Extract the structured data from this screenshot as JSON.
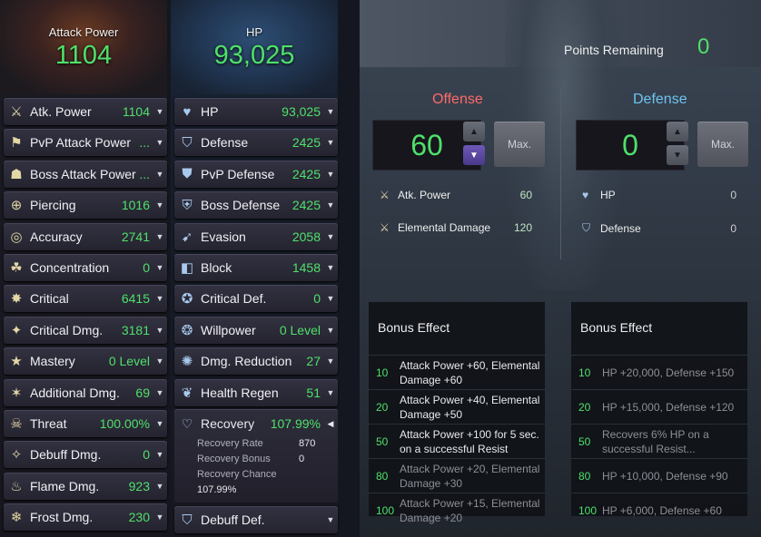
{
  "attack": {
    "title": "Attack Power",
    "value": "1104",
    "rows": [
      {
        "label": "Atk. Power",
        "value": "1104",
        "icon": "swords-icon"
      },
      {
        "label": "PvP Attack Power",
        "value": "...",
        "icon": "pvp-attack-icon"
      },
      {
        "label": "Boss Attack Power",
        "value": "...",
        "icon": "boss-attack-icon"
      },
      {
        "label": "Piercing",
        "value": "1016",
        "icon": "piercing-icon"
      },
      {
        "label": "Accuracy",
        "value": "2741",
        "icon": "accuracy-icon"
      },
      {
        "label": "Concentration",
        "value": "0",
        "icon": "concentration-icon"
      },
      {
        "label": "Critical",
        "value": "6415",
        "icon": "critical-icon"
      },
      {
        "label": "Critical Dmg.",
        "value": "3181",
        "icon": "critical-damage-icon"
      },
      {
        "label": "Mastery",
        "value": "0 Level",
        "icon": "mastery-icon"
      },
      {
        "label": "Additional Dmg.",
        "value": "69",
        "icon": "additional-damage-icon"
      },
      {
        "label": "Threat",
        "value": "100.00%",
        "icon": "threat-skull-icon"
      },
      {
        "label": "Debuff Dmg.",
        "value": "0",
        "icon": "debuff-damage-icon"
      },
      {
        "label": "Flame Dmg.",
        "value": "923",
        "icon": "flame-icon"
      },
      {
        "label": "Frost Dmg.",
        "value": "230",
        "icon": "frost-icon"
      }
    ]
  },
  "hp": {
    "title": "HP",
    "value": "93,025",
    "rows": [
      {
        "label": "HP",
        "value": "93,025",
        "icon": "heart-icon"
      },
      {
        "label": "Defense",
        "value": "2425",
        "icon": "shield-icon"
      },
      {
        "label": "PvP Defense",
        "value": "2425",
        "icon": "pvp-defense-icon"
      },
      {
        "label": "Boss Defense",
        "value": "2425",
        "icon": "boss-defense-icon"
      },
      {
        "label": "Evasion",
        "value": "2058",
        "icon": "evasion-icon"
      },
      {
        "label": "Block",
        "value": "1458",
        "icon": "block-icon"
      },
      {
        "label": "Critical Def.",
        "value": "0",
        "icon": "critical-defense-icon"
      },
      {
        "label": "Willpower",
        "value": "0 Level",
        "icon": "willpower-icon"
      },
      {
        "label": "Dmg. Reduction",
        "value": "27",
        "icon": "damage-reduction-icon"
      },
      {
        "label": "Health Regen",
        "value": "51",
        "icon": "health-regen-icon"
      }
    ],
    "recovery": {
      "label": "Recovery",
      "value": "107.99%",
      "icon": "recovery-icon",
      "details": [
        {
          "k": "Recovery Rate",
          "v": "870"
        },
        {
          "k": "Recovery Bonus",
          "v": "0"
        },
        {
          "k": "Recovery Chance",
          "v": "107.99%"
        }
      ]
    },
    "debuff": {
      "label": "Debuff Def.",
      "icon": "debuff-defense-icon"
    }
  },
  "points": {
    "label": "Points Remaining",
    "value": "0"
  },
  "offense": {
    "title": "Offense",
    "value": "60",
    "max_label": "Max.",
    "stats": [
      {
        "label": "Atk. Power",
        "value": "60",
        "icon": "swords-icon"
      },
      {
        "label": "Elemental Damage",
        "value": "120",
        "icon": "swords-icon"
      }
    ],
    "bonus_title": "Bonus Effect",
    "bonus": [
      {
        "level": "10",
        "text": "Attack Power +60, Elemental Damage +60",
        "active": true
      },
      {
        "level": "20",
        "text": "Attack Power +40, Elemental Damage +50",
        "active": true
      },
      {
        "level": "50",
        "text": "Attack Power +100 for 5 sec. on a successful Resist",
        "active": true
      },
      {
        "level": "80",
        "text": "Attack Power +20, Elemental Damage +30",
        "active": false
      },
      {
        "level": "100",
        "text": "Attack Power +15, Elemental Damage +20",
        "active": false
      }
    ]
  },
  "defense": {
    "title": "Defense",
    "value": "0",
    "max_label": "Max.",
    "stats": [
      {
        "label": "HP",
        "value": "0",
        "icon": "heart-icon"
      },
      {
        "label": "Defense",
        "value": "0",
        "icon": "shield-icon"
      }
    ],
    "bonus_title": "Bonus Effect",
    "bonus": [
      {
        "level": "10",
        "text": "HP +20,000, Defense +150",
        "active": false
      },
      {
        "level": "20",
        "text": "HP +15,000, Defense +120",
        "active": false
      },
      {
        "level": "50",
        "text": "Recovers 6% HP on a successful Resist...",
        "active": false
      },
      {
        "level": "80",
        "text": "HP +10,000, Defense +90",
        "active": false
      },
      {
        "level": "100",
        "text": "HP +6,000, Defense +60",
        "active": false
      }
    ]
  },
  "colors": {
    "accent_green": "#4fe06a",
    "offense_red": "#ff6a6a",
    "defense_blue": "#6ec3f2"
  }
}
